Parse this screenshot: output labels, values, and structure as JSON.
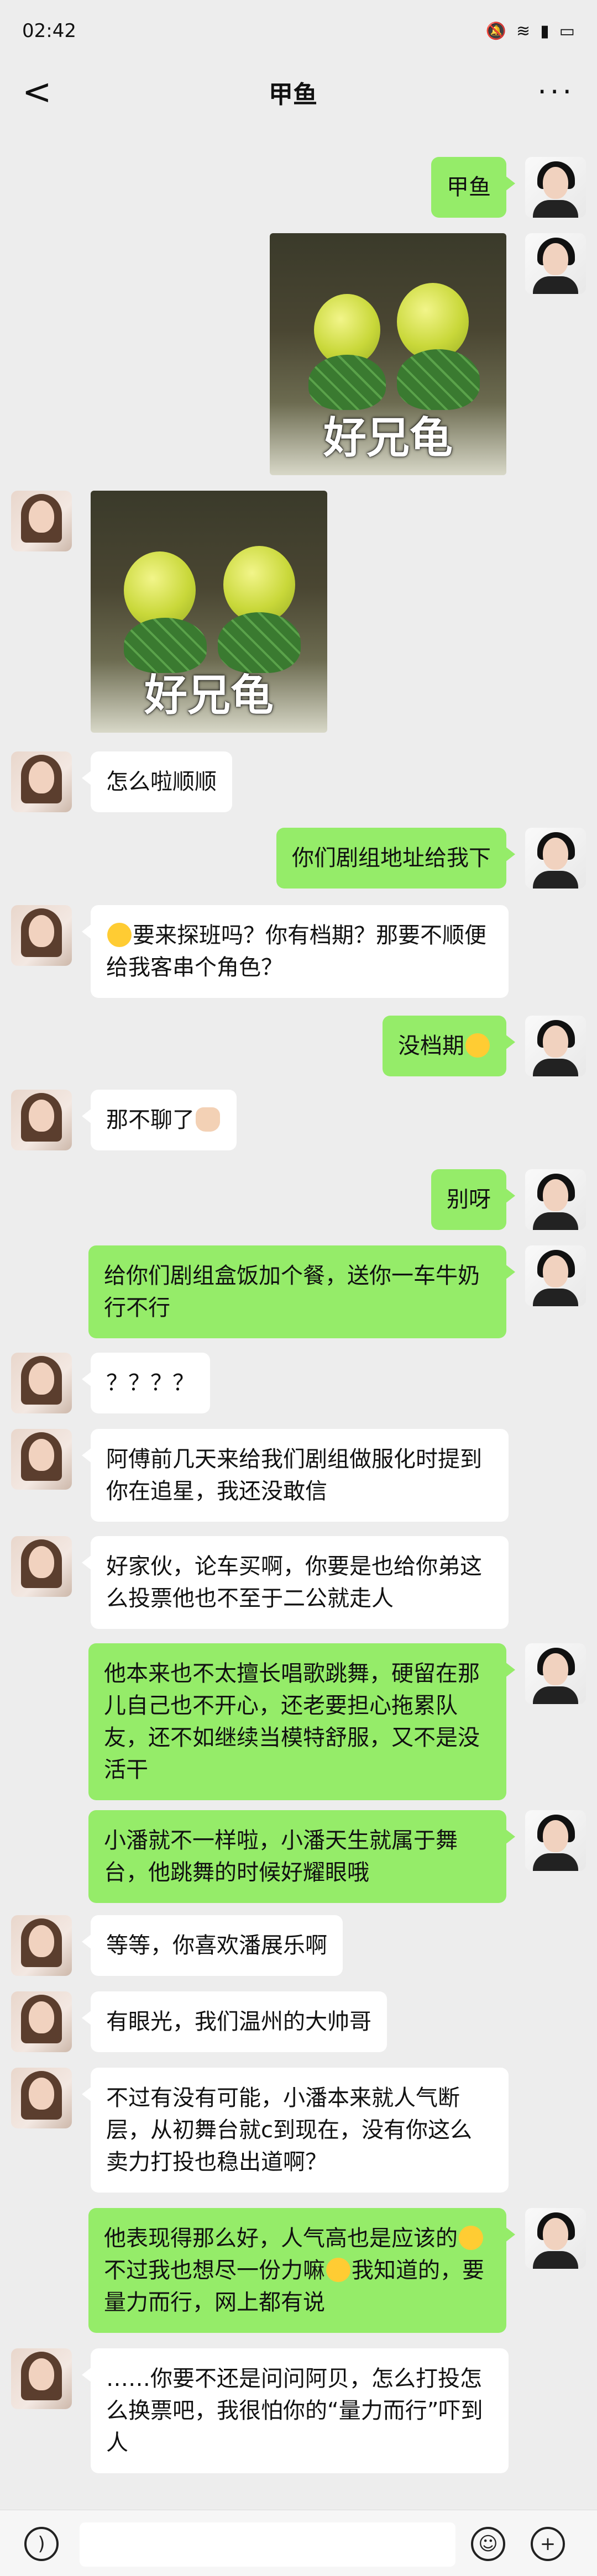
{
  "status": {
    "time": "02:42",
    "icons": [
      "mute-icon",
      "wifi-icon",
      "alert-icon",
      "battery-icon"
    ]
  },
  "nav": {
    "back_label": "<",
    "title": "甲鱼",
    "more_label": "···"
  },
  "messages": {
    "m1": "甲鱼",
    "sticker_caption": "好兄龟",
    "m4": "怎么啦顺顺",
    "m5": "你们剧组地址给我下",
    "m6a": "要来探班吗？你有档期？那要不顺便给我客串个角色？",
    "m7": "没档期",
    "m8": "那不聊了",
    "m9": "别呀",
    "m10": "给你们剧组盒饭加个餐，送你一车牛奶行不行",
    "m11": "？？？？",
    "m12": "阿傅前几天来给我们剧组做服化时提到你在追星，我还没敢信",
    "m13": "好家伙，论车买啊，你要是也给你弟这么投票他也不至于二公就走人",
    "m14": "他本来也不太擅长唱歌跳舞，硬留在那儿自己也不开心，还老要担心拖累队友，还不如继续当模特舒服，又不是没活干",
    "m15": "小潘就不一样啦，小潘天生就属于舞台，他跳舞的时候好耀眼哦",
    "m16": "等等，你喜欢潘展乐啊",
    "m17": "有眼光，我们温州的大帅哥",
    "m18": "不过有没有可能，小潘本来就人气断层，从初舞台就c到现在，没有你这么卖力打投也稳出道啊？",
    "m19a": "他表现得那么好，人气高也是应该的",
    "m19b": "不过我也想尽一份力嘛",
    "m19c": "我知道的，要量力而行，网上都有说",
    "m20": "……你要不还是问问阿贝，怎么打投怎么换票吧，我很怕你的“量力而行”吓到人"
  },
  "colors": {
    "bg": "#ededed",
    "self_bubble": "#95ec69",
    "other_bubble": "#ffffff"
  }
}
